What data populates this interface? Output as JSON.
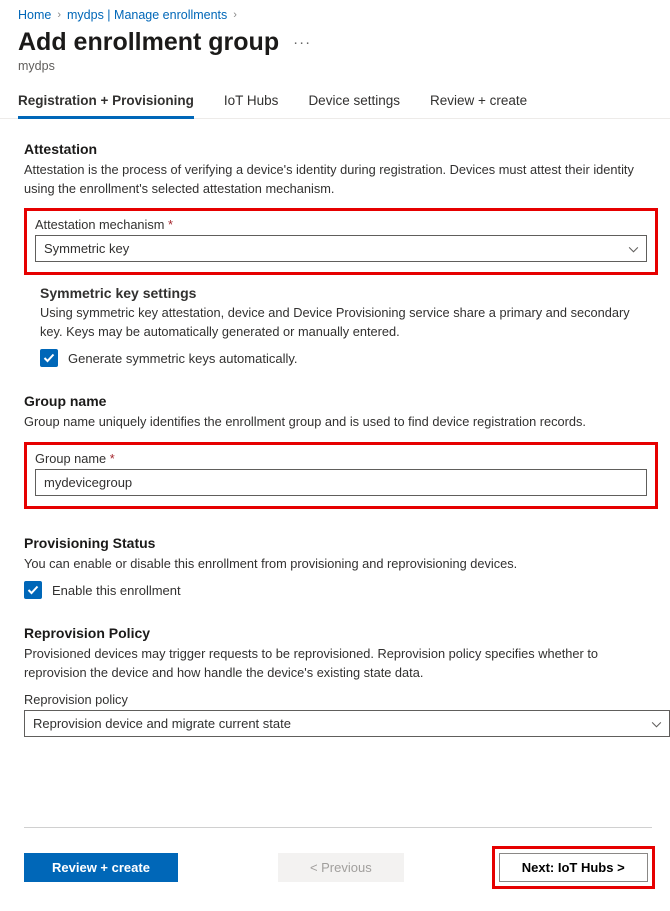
{
  "breadcrumb": {
    "home": "Home",
    "mydps": "mydps | Manage enrollments"
  },
  "header": {
    "title": "Add enrollment group",
    "resource": "mydps"
  },
  "tabs": {
    "reg": "Registration + Provisioning",
    "iot": "IoT Hubs",
    "device": "Device settings",
    "review": "Review + create"
  },
  "attestation": {
    "heading": "Attestation",
    "desc": "Attestation is the process of verifying a device's identity during registration. Devices must attest their identity using the enrollment's selected attestation mechanism.",
    "label": "Attestation mechanism",
    "value": "Symmetric key"
  },
  "symkey": {
    "heading": "Symmetric key settings",
    "desc": "Using symmetric key attestation, device and Device Provisioning service share a primary and secondary key. Keys may be automatically generated or manually entered.",
    "checkbox": "Generate symmetric keys automatically."
  },
  "groupname": {
    "heading": "Group name",
    "desc": "Group name uniquely identifies the enrollment group and is used to find device registration records.",
    "label": "Group name",
    "value": "mydevicegroup"
  },
  "provstatus": {
    "heading": "Provisioning Status",
    "desc": "You can enable or disable this enrollment from provisioning and reprovisioning devices.",
    "checkbox": "Enable this enrollment"
  },
  "reprov": {
    "heading": "Reprovision Policy",
    "desc": "Provisioned devices may trigger requests to be reprovisioned. Reprovision policy specifies whether to reprovision the device and how handle the device's existing state data.",
    "label": "Reprovision policy",
    "value": "Reprovision device and migrate current state"
  },
  "footer": {
    "review": "Review + create",
    "prev": "< Previous",
    "next": "Next: IoT Hubs >"
  }
}
